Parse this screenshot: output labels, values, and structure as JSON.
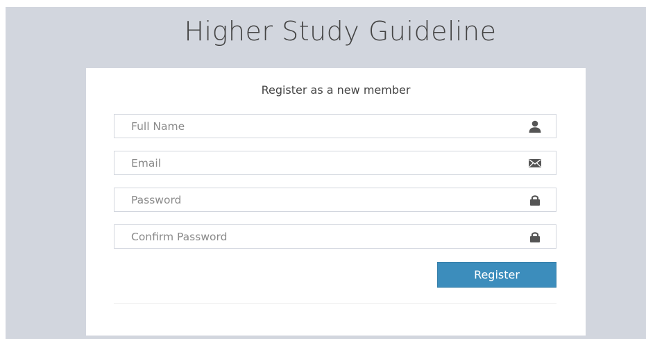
{
  "app": {
    "title": "Higher Study Guideline"
  },
  "register": {
    "heading": "Register as a new member",
    "fields": [
      {
        "placeholder": "Full Name",
        "value": "",
        "icon": "user-icon"
      },
      {
        "placeholder": "Email",
        "value": "",
        "icon": "envelope-icon"
      },
      {
        "placeholder": "Password",
        "value": "",
        "icon": "lock-icon"
      },
      {
        "placeholder": "Confirm Password",
        "value": "",
        "icon": "lock-icon"
      }
    ],
    "submit_label": "Register"
  },
  "colors": {
    "background": "#d2d6de",
    "card": "#ffffff",
    "primary_button": "#3c8dbc",
    "icon": "#555555"
  }
}
